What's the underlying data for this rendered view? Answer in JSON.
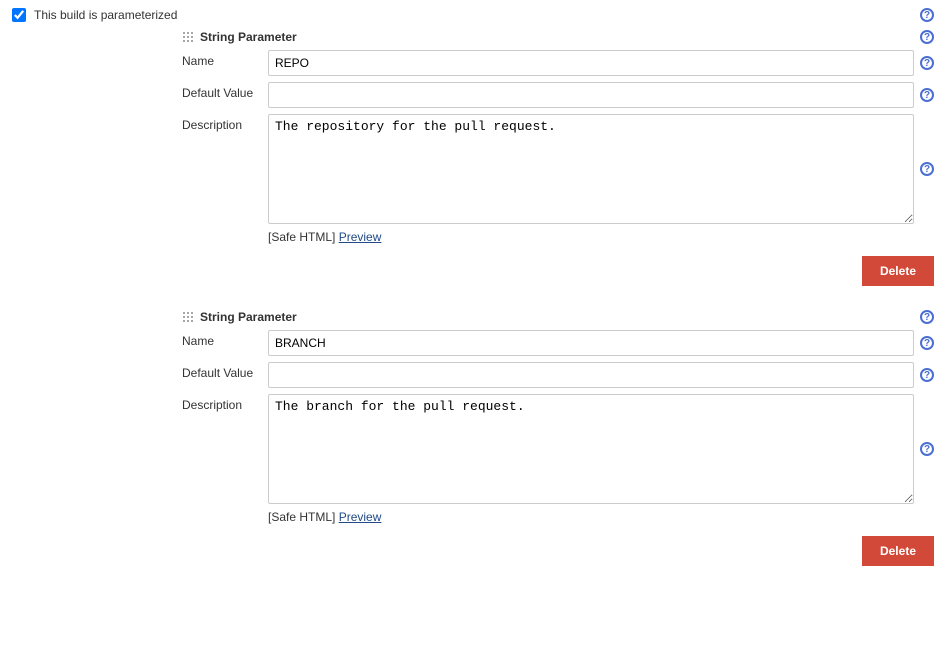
{
  "topCheckboxLabel": "This build is parameterized",
  "topCheckboxChecked": true,
  "safeHtmlLabel": "[Safe HTML]",
  "previewLabel": "Preview",
  "deleteLabel": "Delete",
  "helpGlyph": "?",
  "labels": {
    "name": "Name",
    "defaultValue": "Default Value",
    "description": "Description"
  },
  "params": [
    {
      "title": "String Parameter",
      "name": "REPO",
      "defaultValue": "",
      "description": "The repository for the pull request."
    },
    {
      "title": "String Parameter",
      "name": "BRANCH",
      "defaultValue": "",
      "description": "The branch for the pull request."
    }
  ]
}
